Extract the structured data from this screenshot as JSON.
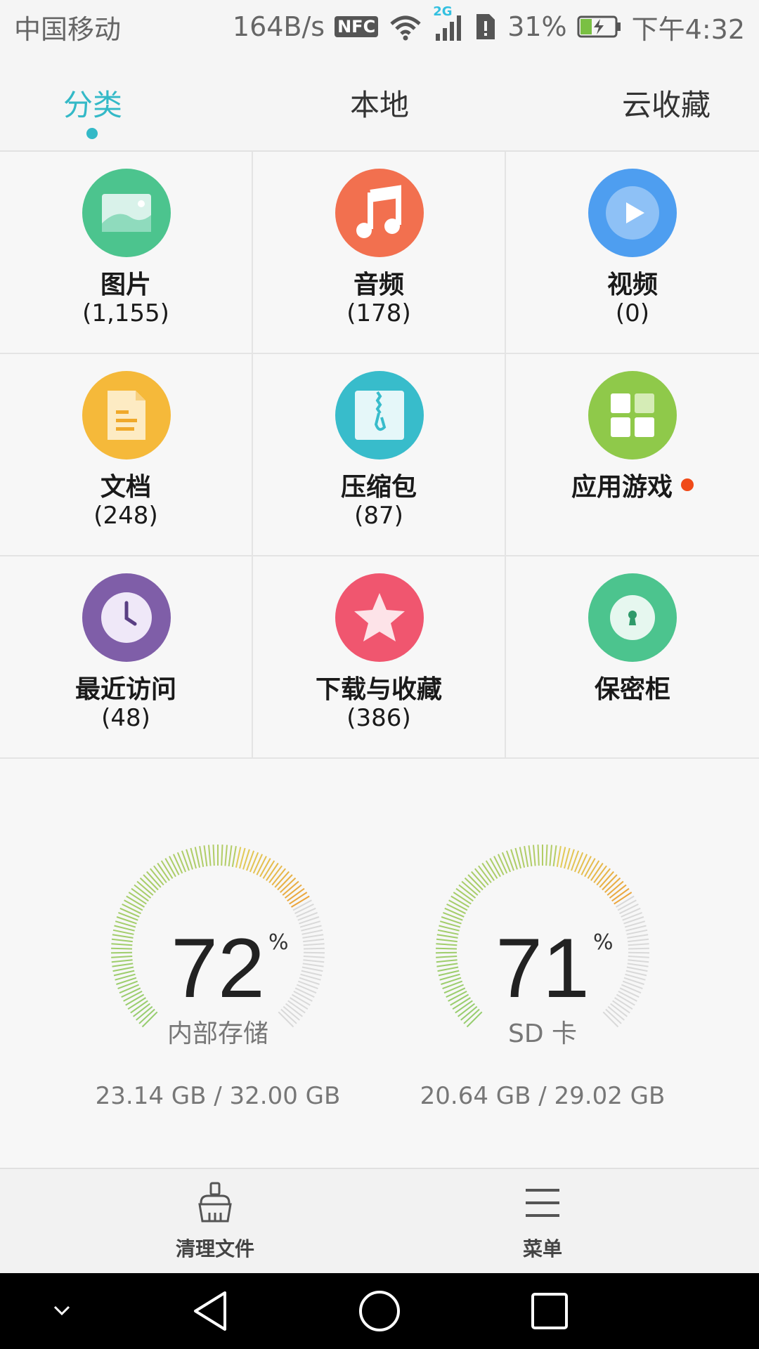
{
  "status_bar": {
    "carrier": "中国移动",
    "net_speed": "164B/s",
    "nfc": "NFC",
    "network_type": "2G",
    "battery": "31%",
    "time": "下午4:32"
  },
  "tabs": [
    {
      "label": "分类",
      "active": true
    },
    {
      "label": "本地",
      "active": false
    },
    {
      "label": "云收藏",
      "active": false
    }
  ],
  "categories": [
    {
      "label": "图片",
      "count": "(1,155)",
      "icon": "image-icon",
      "color": "#4cc48e"
    },
    {
      "label": "音频",
      "count": "(178)",
      "icon": "music-icon",
      "color": "#f2704f"
    },
    {
      "label": "视频",
      "count": "(0)",
      "icon": "video-icon",
      "color": "#4e9ef0"
    },
    {
      "label": "文档",
      "count": "(248)",
      "icon": "document-icon",
      "color": "#f5b93a"
    },
    {
      "label": "压缩包",
      "count": "(87)",
      "icon": "zip-icon",
      "color": "#38bccb"
    },
    {
      "label": "应用游戏",
      "count": "",
      "icon": "apps-icon",
      "color": "#8fc94a"
    },
    {
      "label": "最近访问",
      "count": "(48)",
      "icon": "clock-icon",
      "color": "#7f5ea8"
    },
    {
      "label": "下载与收藏",
      "count": "(386)",
      "icon": "star-icon",
      "color": "#f0566f"
    },
    {
      "label": "保密柜",
      "count": "",
      "icon": "safe-icon",
      "color": "#4cc48e"
    }
  ],
  "storage": [
    {
      "percent": "72",
      "percent_sign": "%",
      "used_fraction": 0.72,
      "label": "内部存储",
      "size": "23.14 GB / 32.00 GB"
    },
    {
      "percent": "71",
      "percent_sign": "%",
      "used_fraction": 0.71,
      "label": "SD 卡",
      "size": "20.64 GB / 29.02 GB"
    }
  ],
  "actions": [
    {
      "label": "清理文件",
      "icon": "broom-icon"
    },
    {
      "label": "菜单",
      "icon": "menu-icon"
    }
  ],
  "system_nav": [
    "chevron-down-icon",
    "back-icon",
    "home-icon",
    "recents-icon"
  ]
}
